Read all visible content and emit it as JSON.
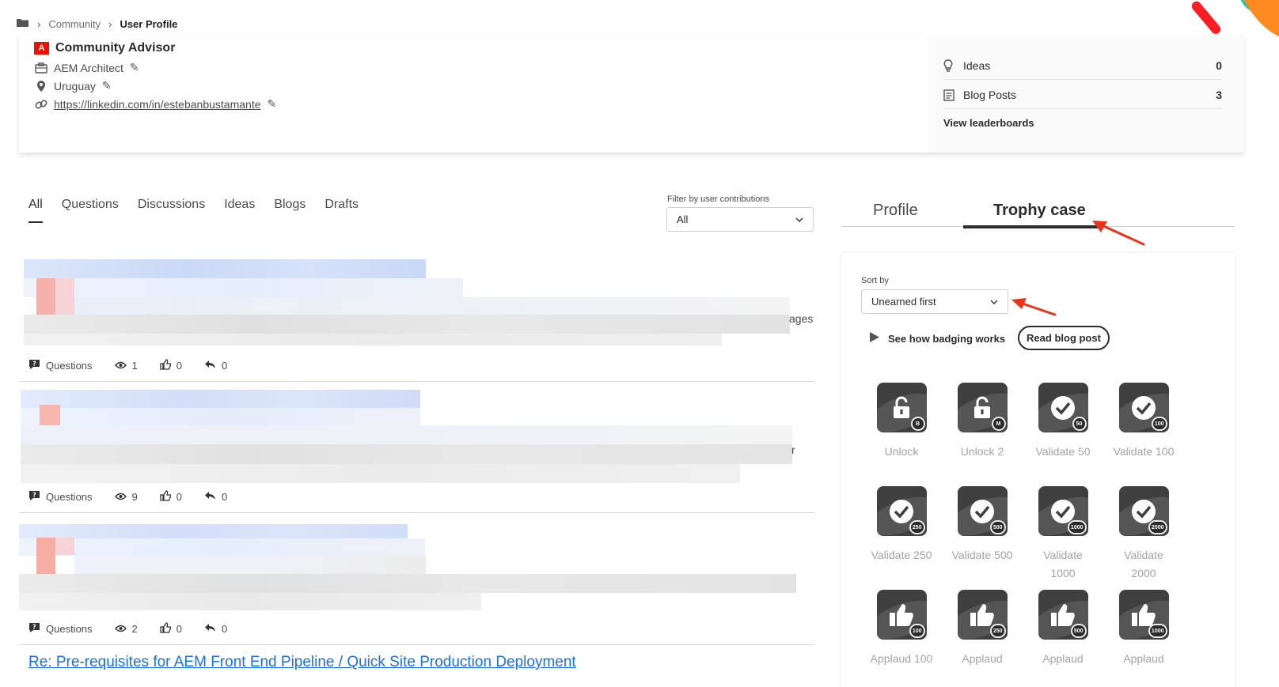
{
  "breadcrumb": {
    "items": [
      "Community",
      "User Profile"
    ]
  },
  "profile": {
    "rank": "Community Advisor",
    "job_title": "AEM Architect",
    "location": "Uruguay",
    "link": "https://linkedin.com/in/estebanbustamante"
  },
  "stats": {
    "rows": [
      {
        "label": "Ideas",
        "value": "0"
      },
      {
        "label": "Blog Posts",
        "value": "3"
      }
    ],
    "leaderboards_link": "View leaderboards"
  },
  "content_tabs": [
    "All",
    "Questions",
    "Discussions",
    "Ideas",
    "Blogs",
    "Drafts"
  ],
  "filter": {
    "label": "Filter by user contributions",
    "value": "All"
  },
  "posts": [
    {
      "type": "Questions",
      "views": "1",
      "likes": "0",
      "replies": "0",
      "visible_fragment": "ages"
    },
    {
      "type": "Questions",
      "views": "9",
      "likes": "0",
      "replies": "0",
      "visible_fragment": "r"
    },
    {
      "type": "Questions",
      "views": "2",
      "likes": "0",
      "replies": "0",
      "visible_fragment": ""
    }
  ],
  "thread_link": "Re: Pre-requisites for AEM Front End Pipeline / Quick Site Production Deployment",
  "side_tabs": {
    "profile": "Profile",
    "trophy": "Trophy case"
  },
  "trophy": {
    "sort_label": "Sort by",
    "sort_value": "Unearned first",
    "howto": "See how badging works",
    "blog_button": "Read blog post",
    "badges": [
      {
        "name": "Unlock",
        "level": "B",
        "icon": "unlock-icon"
      },
      {
        "name": "Unlock 2",
        "level": "M",
        "icon": "unlock-icon"
      },
      {
        "name": "Validate 50",
        "level": "50",
        "icon": "check-icon"
      },
      {
        "name": "Validate 100",
        "level": "100",
        "icon": "check-icon"
      },
      {
        "name": "Validate 250",
        "level": "250",
        "icon": "check-icon"
      },
      {
        "name": "Validate 500",
        "level": "500",
        "icon": "check-icon"
      },
      {
        "name": "Validate 1000",
        "level": "1000",
        "icon": "check-icon"
      },
      {
        "name": "Validate 2000",
        "level": "2000",
        "icon": "check-icon"
      },
      {
        "name": "Applaud 100",
        "level": "100",
        "icon": "thumbs-up-icon"
      },
      {
        "name": "Applaud",
        "level": "250",
        "icon": "thumbs-up-icon"
      },
      {
        "name": "Applaud",
        "level": "500",
        "icon": "thumbs-up-icon"
      },
      {
        "name": "Applaud",
        "level": "1000",
        "icon": "thumbs-up-icon"
      }
    ]
  },
  "colors": {
    "accent_link": "#1473e6",
    "adobe_red": "#eb1000",
    "annotation_arrow": "#e8341c"
  }
}
